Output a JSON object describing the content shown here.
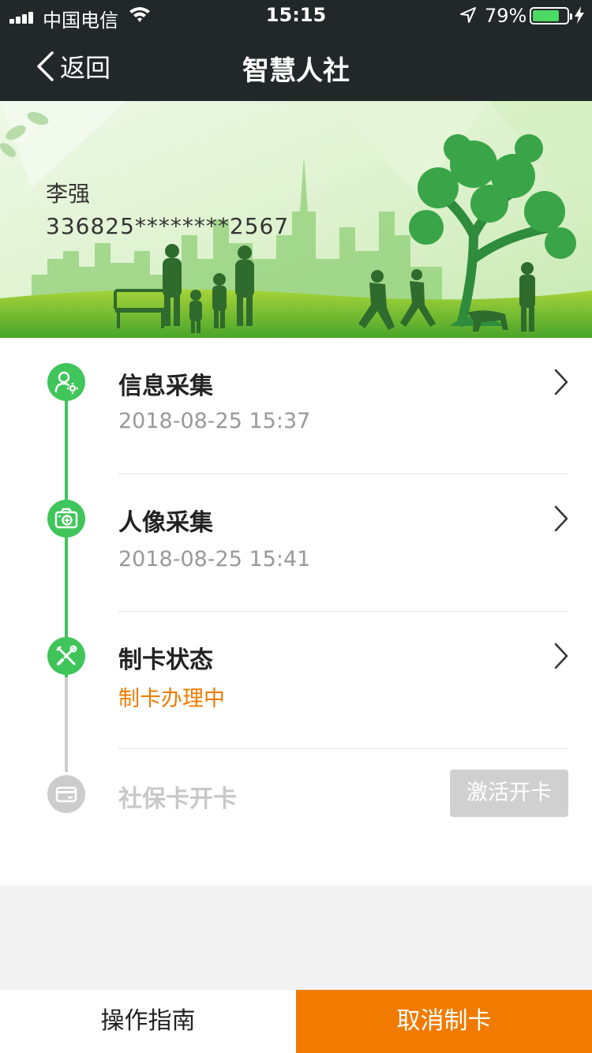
{
  "status_bar": {
    "carrier": "中国电信",
    "time": "15:15",
    "battery_percent": "79%",
    "battery_level": 0.79
  },
  "nav": {
    "back_label": "返回",
    "title": "智慧人社"
  },
  "card": {
    "name": "李强",
    "id_masked": "336825********2567"
  },
  "steps": [
    {
      "title": "信息采集",
      "subtitle": "2018-08-25   15:37",
      "status": "done",
      "icon": "user-gear-icon"
    },
    {
      "title": "人像采集",
      "subtitle": "2018-08-25   15:41",
      "status": "done",
      "icon": "camera-icon"
    },
    {
      "title": "制卡状态",
      "subtitle": "制卡办理中",
      "status": "in-progress",
      "icon": "tools-icon"
    },
    {
      "title": "社保卡开卡",
      "subtitle": "",
      "status": "pending",
      "icon": "card-icon"
    }
  ],
  "activate_button": "激活开卡",
  "footer": {
    "guide_label": "操作指南",
    "cancel_label": "取消制卡"
  },
  "colors": {
    "accent_green": "#3fc55a",
    "accent_orange": "#f07b00",
    "header_bg": "#22282a",
    "disabled": "#cccccc"
  }
}
